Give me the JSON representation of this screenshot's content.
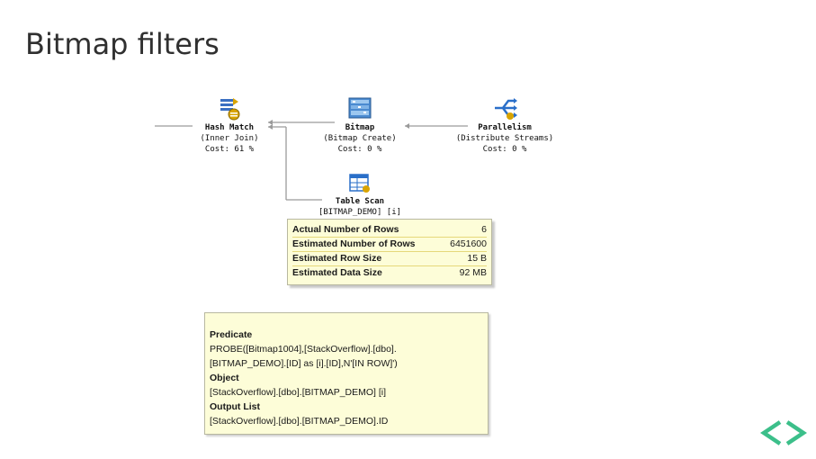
{
  "slide": {
    "title": "Bitmap filters"
  },
  "plan": {
    "hash_match": {
      "op": "Hash Match",
      "sub": "(Inner Join)",
      "cost": "Cost: 61 %"
    },
    "bitmap": {
      "op": "Bitmap",
      "sub": "(Bitmap Create)",
      "cost": "Cost: 0 %"
    },
    "parallelism": {
      "op": "Parallelism",
      "sub": "(Distribute Streams)",
      "cost": "Cost: 0 %"
    },
    "table_scan": {
      "op": "Table Scan",
      "sub": "[BITMAP_DEMO] [i]"
    }
  },
  "tooltip_rows": {
    "rows": [
      {
        "label": "Actual Number of Rows",
        "value": "6"
      },
      {
        "label": "Estimated Number of Rows",
        "value": "6451600"
      },
      {
        "label": "Estimated Row Size",
        "value": "15 B"
      },
      {
        "label": "Estimated Data Size",
        "value": "92 MB"
      }
    ]
  },
  "tooltip_details": {
    "predicate_heading": "Predicate",
    "predicate_line1": "PROBE([Bitmap1004],[StackOverflow].[dbo].",
    "predicate_line2": "[BITMAP_DEMO].[ID] as [i].[ID],N'[IN ROW]')",
    "object_heading": "Object",
    "object_text": "[StackOverflow].[dbo].[BITMAP_DEMO] [i]",
    "output_heading": "Output List",
    "output_text": "[StackOverflow].[dbo].[BITMAP_DEMO].ID"
  },
  "colors": {
    "nav_accent": "#3cbf8a",
    "tooltip_bg": "#fdfdd8"
  },
  "icons": [
    "hash-match-icon",
    "bitmap-icon",
    "parallelism-icon",
    "table-scan-icon",
    "chevron-left-icon",
    "chevron-right-icon"
  ]
}
